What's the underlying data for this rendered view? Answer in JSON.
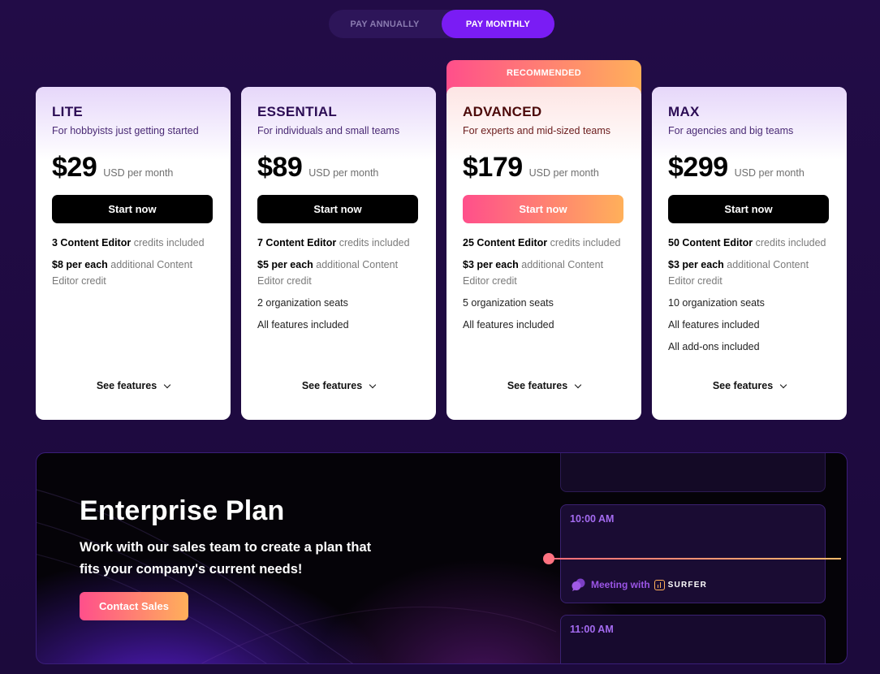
{
  "billing_toggle": {
    "annual_label": "PAY ANNUALLY",
    "monthly_label": "PAY MONTHLY",
    "selected": "monthly"
  },
  "recommended_badge": "RECOMMENDED",
  "plans": [
    {
      "name": "LITE",
      "description": "For hobbyists just getting started",
      "price": "$29",
      "price_unit": "USD per month",
      "cta": "Start now",
      "features": [
        {
          "bold": "3 Content Editor",
          "rest": " credits included"
        },
        {
          "bold": "$8 per each",
          "rest": " additional Content Editor credit"
        }
      ],
      "see_features": "See features"
    },
    {
      "name": "ESSENTIAL",
      "description": "For individuals and small teams",
      "price": "$89",
      "price_unit": "USD per month",
      "cta": "Start now",
      "features": [
        {
          "bold": "7 Content Editor",
          "rest": " credits included"
        },
        {
          "bold": "$5 per each",
          "rest": " additional Content Editor credit"
        },
        {
          "bold": "",
          "rest": "2 organization seats"
        },
        {
          "bold": "",
          "rest": "All features included"
        }
      ],
      "see_features": "See features"
    },
    {
      "name": "ADVANCED",
      "description": "For experts and mid-sized teams",
      "price": "$179",
      "price_unit": "USD per month",
      "cta": "Start now",
      "features": [
        {
          "bold": "25 Content Editor",
          "rest": " credits included"
        },
        {
          "bold": "$3 per each",
          "rest": " additional Content Editor credit"
        },
        {
          "bold": "",
          "rest": "5 organization seats"
        },
        {
          "bold": "",
          "rest": "All features included"
        }
      ],
      "see_features": "See features"
    },
    {
      "name": "MAX",
      "description": "For agencies and big teams",
      "price": "$299",
      "price_unit": "USD per month",
      "cta": "Start now",
      "features": [
        {
          "bold": "50 Content Editor",
          "rest": " credits included"
        },
        {
          "bold": "$3 per each",
          "rest": " additional Content Editor credit"
        },
        {
          "bold": "",
          "rest": "10 organization seats"
        },
        {
          "bold": "",
          "rest": "All features included"
        },
        {
          "bold": "",
          "rest": "All add-ons included"
        }
      ],
      "see_features": "See features"
    }
  ],
  "enterprise": {
    "title": "Enterprise Plan",
    "description": "Work with our sales team to create a plan that fits your company's current needs!",
    "cta": "Contact Sales",
    "calendar": {
      "slot_1_time": "10:00 AM",
      "slot_2_time": "11:00 AM",
      "meeting_label": "Meeting with",
      "meeting_brand": "SURFER"
    }
  },
  "colors": {
    "background": "#220c47",
    "toggle_active": "#7a1cf4",
    "accent_gradient_start": "#ff4f8b",
    "accent_gradient_end": "#ffb05a",
    "plan_name": "#2c0d55"
  }
}
